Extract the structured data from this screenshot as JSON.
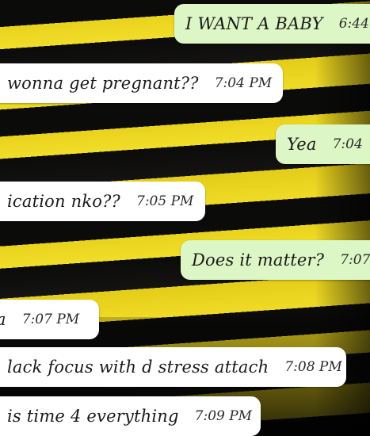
{
  "chat": {
    "messages": [
      {
        "direction": "outgoing",
        "text": "I WANT A BABY",
        "time": "6:44"
      },
      {
        "direction": "incoming",
        "text": "wonna get pregnant??",
        "time": "7:04 PM"
      },
      {
        "direction": "outgoing",
        "text": "Yea",
        "time": "7:04"
      },
      {
        "direction": "incoming",
        "text": "ication nko??",
        "time": "7:05 PM"
      },
      {
        "direction": "outgoing",
        "text": "Does it matter?",
        "time": "7:07"
      },
      {
        "direction": "incoming",
        "text": "a",
        "time": "7:07 PM"
      },
      {
        "direction": "incoming",
        "text": "lack focus with d stress attach",
        "time": "7:08 PM"
      },
      {
        "direction": "incoming",
        "text": "is time 4 everything",
        "time": "7:09 PM"
      }
    ]
  }
}
